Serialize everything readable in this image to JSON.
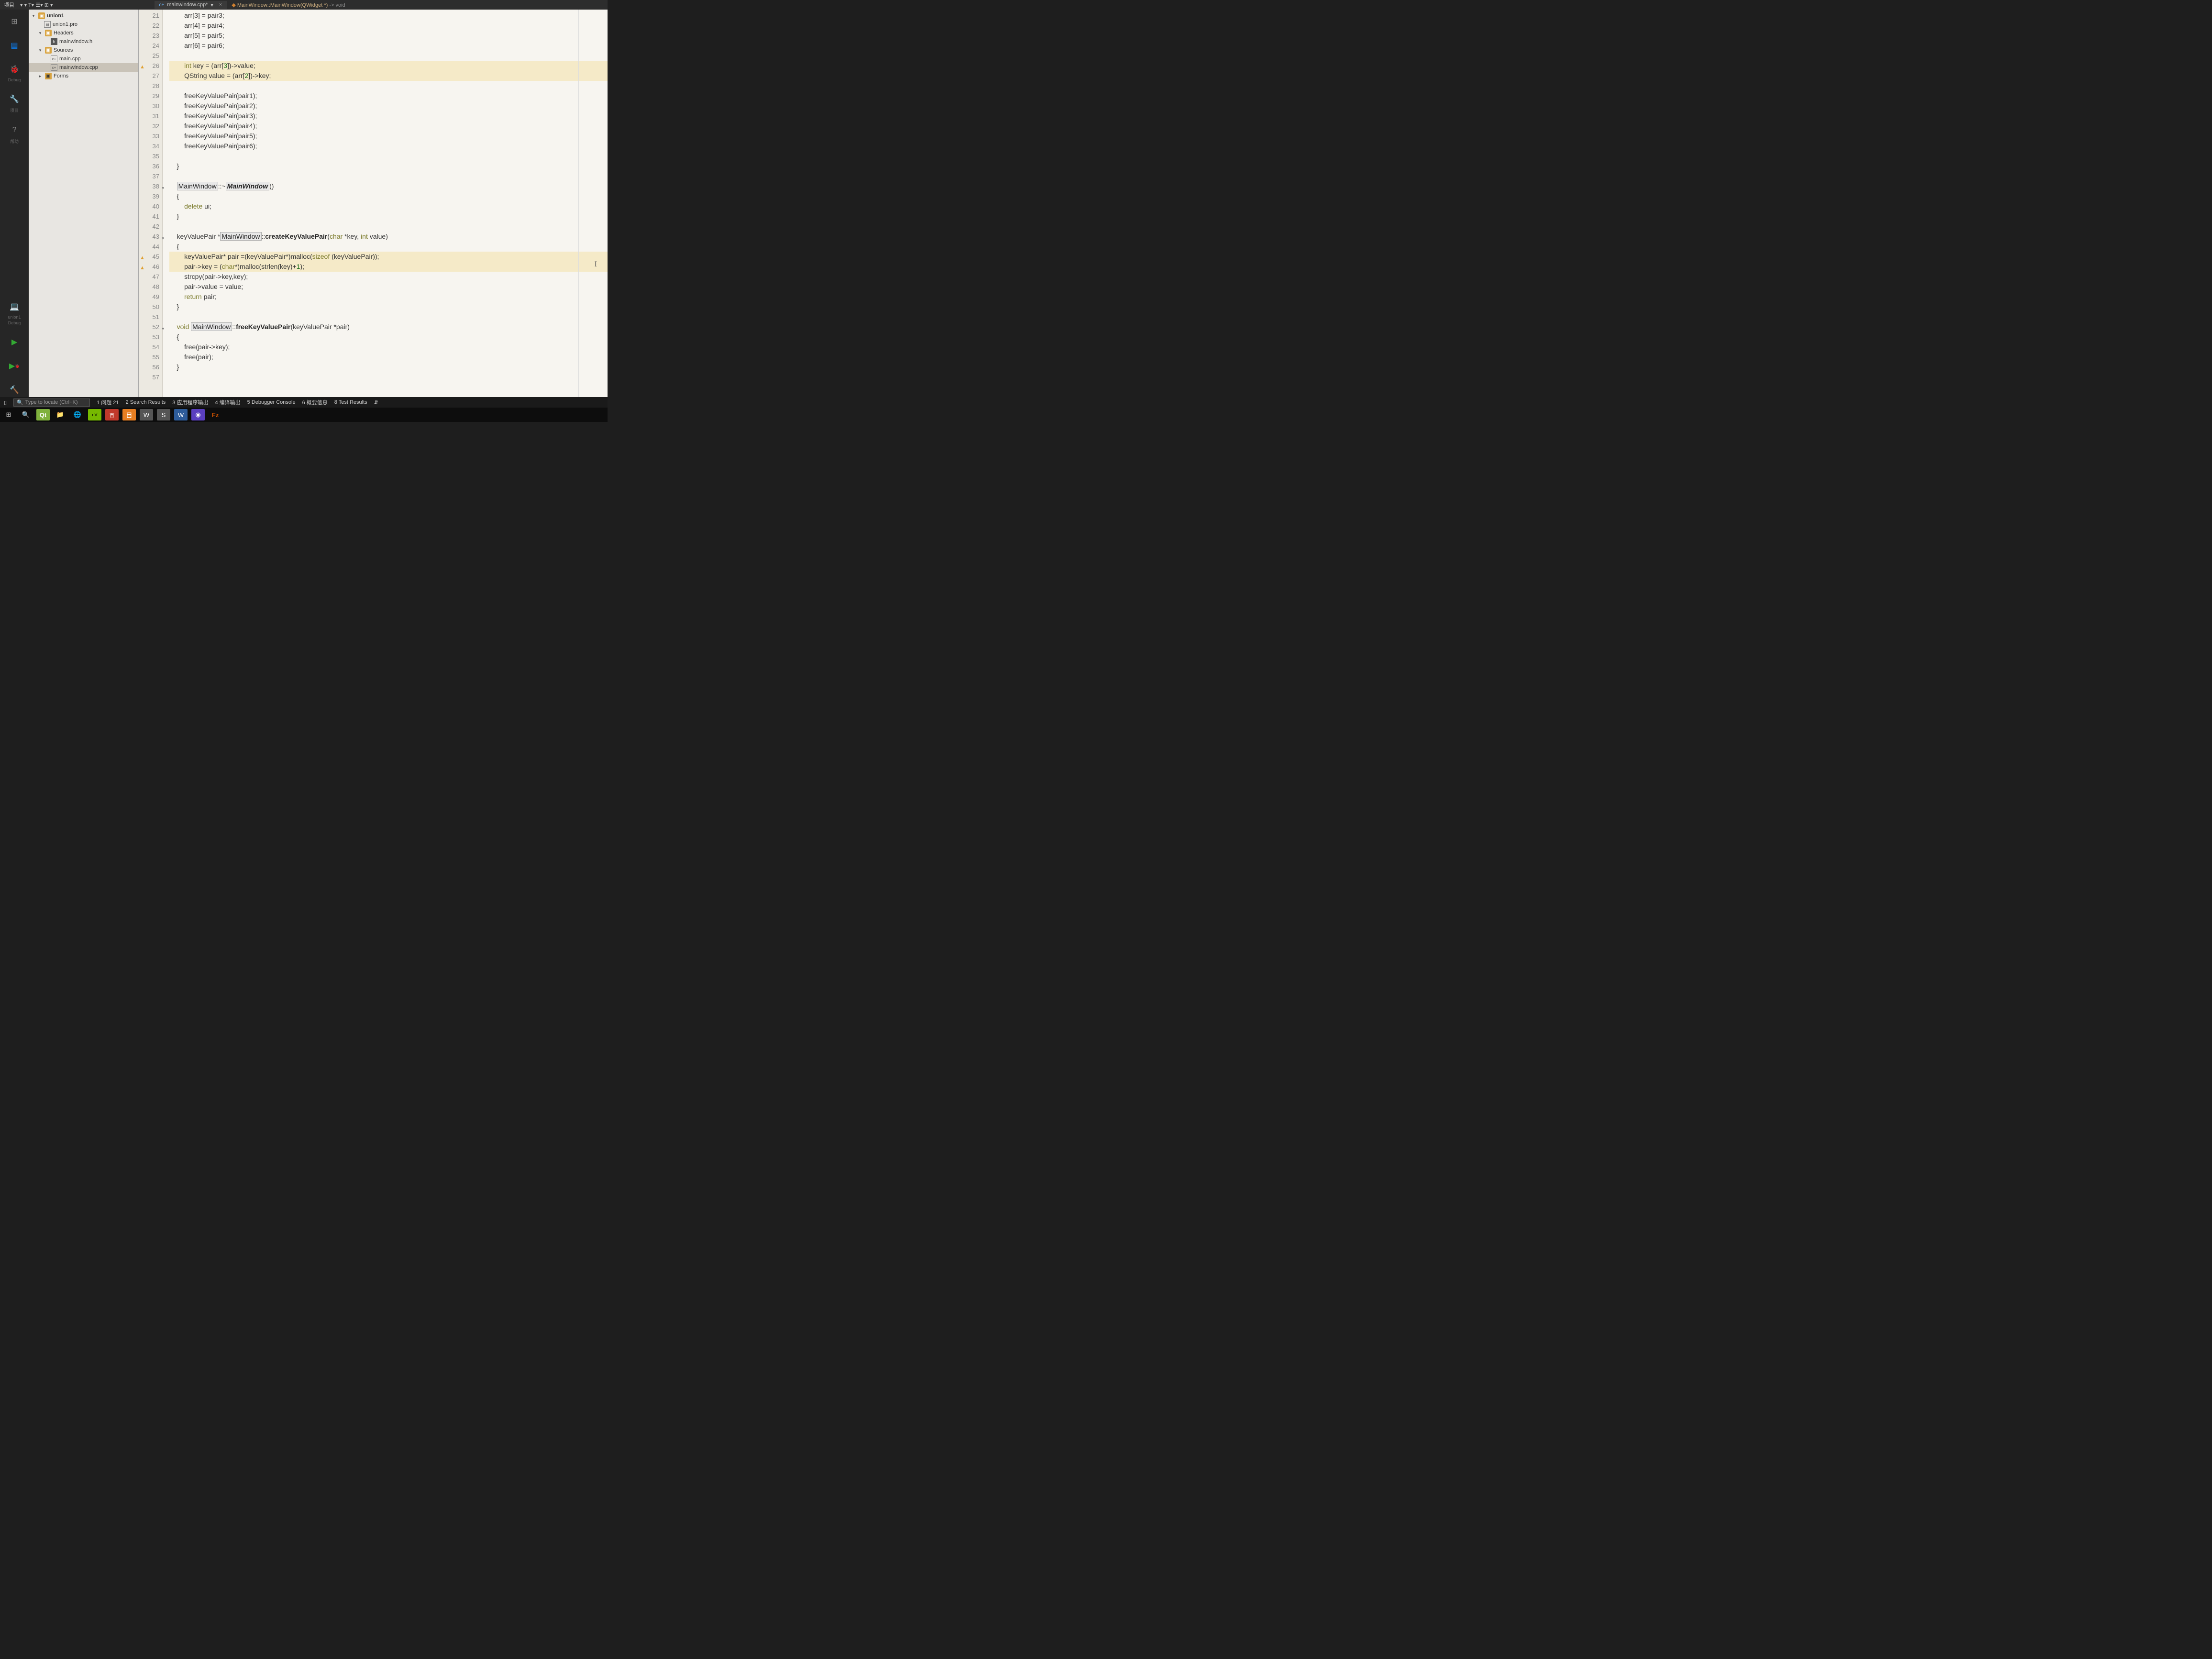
{
  "topbar": {
    "menu": "项目",
    "tab": "mainwindow.cpp*",
    "breadcrumb_class": "MainWindow::MainWindow(QWidget *)",
    "breadcrumb_ret": " -> void"
  },
  "leftrail": {
    "item_debug": "Debug",
    "item_project": "项目",
    "item_help": "帮助",
    "mode_project": "union1",
    "mode_debug": "Debug"
  },
  "tree": {
    "root": "union1",
    "pro": "union1.pro",
    "headers": "Headers",
    "h1": "mainwindow.h",
    "sources": "Sources",
    "s1": "main.cpp",
    "s2": "mainwindow.cpp",
    "forms": "Forms"
  },
  "lines": {
    "start": 21,
    "warn": [
      26,
      45,
      46
    ],
    "fold": [
      38,
      43,
      52
    ]
  },
  "code": {
    "l21": "        arr[3] = pair3;",
    "l22": "        arr[4] = pair4;",
    "l23": "        arr[5] = pair5;",
    "l24": "        arr[6] = pair6;",
    "l25": "",
    "l26a": "        ",
    "l26_kw": "int",
    "l26b": " key = (arr[",
    "l26_n": "3",
    "l26c": "])->value;",
    "l27a": "        QString value = (arr[",
    "l27_n": "2",
    "l27b": "])->key;",
    "l28": "",
    "l29": "        freeKeyValuePair(pair1);",
    "l30": "        freeKeyValuePair(pair2);",
    "l31": "        freeKeyValuePair(pair3);",
    "l32": "        freeKeyValuePair(pair4);",
    "l33": "        freeKeyValuePair(pair5);",
    "l34": "        freeKeyValuePair(pair6);",
    "l35": "",
    "l36": "    }",
    "l37": "",
    "l38a": "    ",
    "l38_cls": "MainWindow",
    "l38b": "::~",
    "l38_fn": "MainWindow",
    "l38c": "()",
    "l39": "    {",
    "l40a": "        ",
    "l40_kw": "delete",
    "l40b": " ui;",
    "l41": "    }",
    "l42": "",
    "l43a": "    keyValuePair *",
    "l43_cls": "MainWindow",
    "l43b": "::",
    "l43_fn": "createKeyValuePair",
    "l43c": "(",
    "l43_kw": "char",
    "l43d": " *key, ",
    "l43_kw2": "int",
    "l43e": " value)",
    "l44": "    {",
    "l45a": "        keyValuePair* pair =(keyValuePair*)malloc(",
    "l45_kw": "sizeof",
    "l45b": " (keyValuePair));",
    "l46a": "        pair->key = (",
    "l46_kw": "char",
    "l46b": "*)malloc(strlen(key)+",
    "l46_n": "1",
    "l46c": ");",
    "l47": "        strcpy(pair->key,key);",
    "l48": "        pair->value = value;",
    "l49a": "        ",
    "l49_kw": "return",
    "l49b": " pair;",
    "l50": "    }",
    "l51": "",
    "l52a": "    ",
    "l52_kw": "void",
    "l52b": " ",
    "l52_cls": "MainWindow",
    "l52c": "::",
    "l52_fn": "freeKeyValuePair",
    "l52d": "(keyValuePair *pair)",
    "l53": "    {",
    "l54": "        free(pair->key);",
    "l55": "        free(pair);",
    "l56": "    }",
    "l57": ""
  },
  "statusbar": {
    "search_placeholder": "Type to locate (Ctrl+K)",
    "i1": "1 问题 21",
    "i2": "2 Search Results",
    "i3": "3 应用程序输出",
    "i4": "4 编译输出",
    "i5": "5 Debugger Console",
    "i6": "6 概要信息",
    "i8": "8 Test Results"
  }
}
